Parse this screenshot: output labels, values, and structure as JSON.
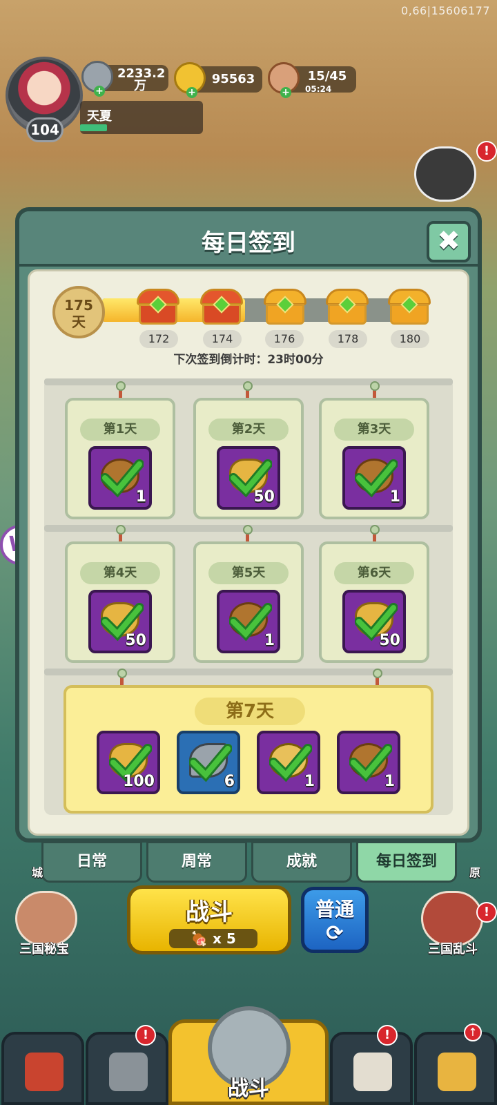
{
  "status": {
    "corner_id": "0,66|15606177"
  },
  "player": {
    "level": "104",
    "name": "天夏",
    "exp_fraction": 0.22
  },
  "resources": {
    "silver": {
      "value": "2233.2",
      "unit": "万",
      "icon": "silver-coin-icon"
    },
    "gold": {
      "value": "95563",
      "icon": "gold-ingot-icon"
    },
    "stamina": {
      "value": "15/45",
      "timer": "05:24",
      "icon": "meat-icon"
    }
  },
  "modal": {
    "title": "每日签到",
    "close_icon": "close-icon",
    "progress": {
      "days_value": "175",
      "days_unit": "天",
      "fill_fraction": 0.45,
      "milestones": [
        "172",
        "174",
        "176",
        "178",
        "180"
      ]
    },
    "countdown": "下次签到倒计时：23时00分",
    "days": [
      {
        "label": "第1天",
        "qty": "1"
      },
      {
        "label": "第2天",
        "qty": "50"
      },
      {
        "label": "第3天",
        "qty": "1"
      },
      {
        "label": "第4天",
        "qty": "50"
      },
      {
        "label": "第5天",
        "qty": "1"
      },
      {
        "label": "第6天",
        "qty": "50"
      }
    ],
    "day7": {
      "label": "第7天",
      "items": [
        "100",
        "6",
        "1",
        "1"
      ]
    }
  },
  "tabs": [
    "日常",
    "周常",
    "成就",
    "每日签到"
  ],
  "active_tab": "每日签到",
  "fight": {
    "label": "战斗",
    "cost": "x 5"
  },
  "mode": {
    "label": "普通"
  },
  "side": {
    "left_label": "三国秘宝",
    "right_label": "三国乱斗",
    "right_partial": "原",
    "left_partial": "城"
  },
  "nav": {
    "center_label": "战斗"
  },
  "colors": {
    "accent_green": "#58857a",
    "alert_red": "#d8262d",
    "gold": "#f3c22e",
    "purple_item": "#7a2fa0"
  }
}
